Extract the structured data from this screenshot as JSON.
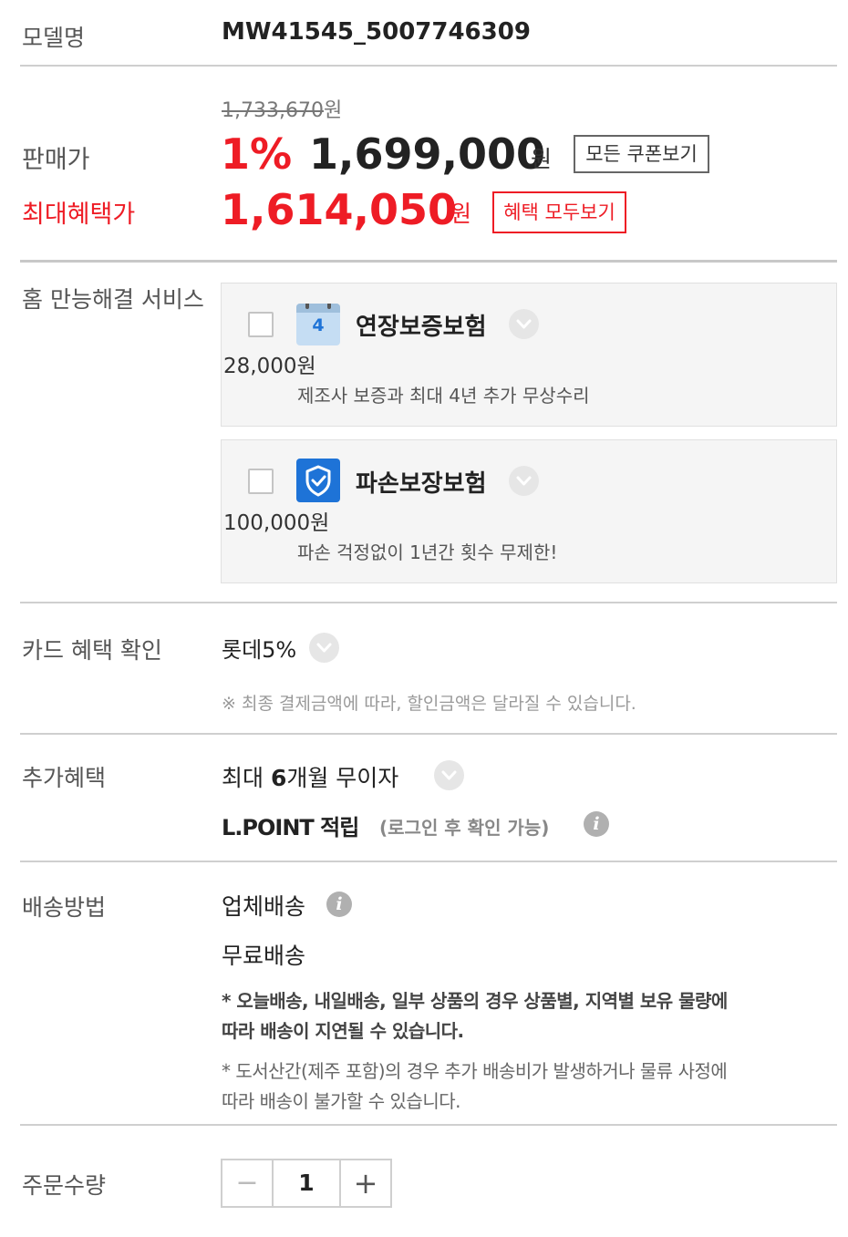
{
  "model": {
    "label": "모델명",
    "value": "MW41545_5007746309"
  },
  "price": {
    "original": "1,733,670",
    "original_unit": "원",
    "sale_label": "판매가",
    "discount": "1%",
    "sale_price": "1,699,000",
    "unit": "원",
    "coupon_button": "모든 쿠폰보기",
    "max_label": "최대혜택가",
    "max_price": "1,614,050",
    "max_unit": "원",
    "benefit_button": "혜택 모두보기",
    "accent_color": "#ee1c25"
  },
  "service": {
    "label": "홈 만능해결 서비스",
    "items": [
      {
        "title": "연장보증보험",
        "price": "28,000원",
        "desc": "제조사 보증과 최대 4년 추가 무상수리",
        "icon": "calendar-icon",
        "icon_text": "4"
      },
      {
        "title": "파손보장보험",
        "price": "100,000원",
        "desc": "파손 걱정없이 1년간 횟수 무제한!",
        "icon": "shield-check-icon"
      }
    ]
  },
  "card": {
    "label": "카드 혜택 확인",
    "value": "롯데5%",
    "note": "※ 최종 결제금액에 따라, 할인금액은 달라질 수 있습니다."
  },
  "extra": {
    "label": "추가혜택",
    "installment_prefix": "최대 ",
    "installment_months": "6",
    "installment_suffix": "개월 무이자",
    "lpoint": "L.POINT 적립",
    "lpoint_note": "(로그인 후 확인 가능)"
  },
  "delivery": {
    "label": "배송방법",
    "method": "업체배송",
    "fee": "무료배송",
    "note1_line1": "* 오늘배송, 내일배송, 일부 상품의 경우 상품별, 지역별 보유 물량에",
    "note1_line2": "따라 배송이 지연될 수 있습니다.",
    "note2_line1": "* 도서산간(제주 포함)의 경우 추가 배송비가 발생하거나 물류 사정에",
    "note2_line2": "따라 배송이 불가할 수 있습니다."
  },
  "quantity": {
    "label": "주문수량",
    "minus": "−",
    "value": "1",
    "plus": "+"
  }
}
